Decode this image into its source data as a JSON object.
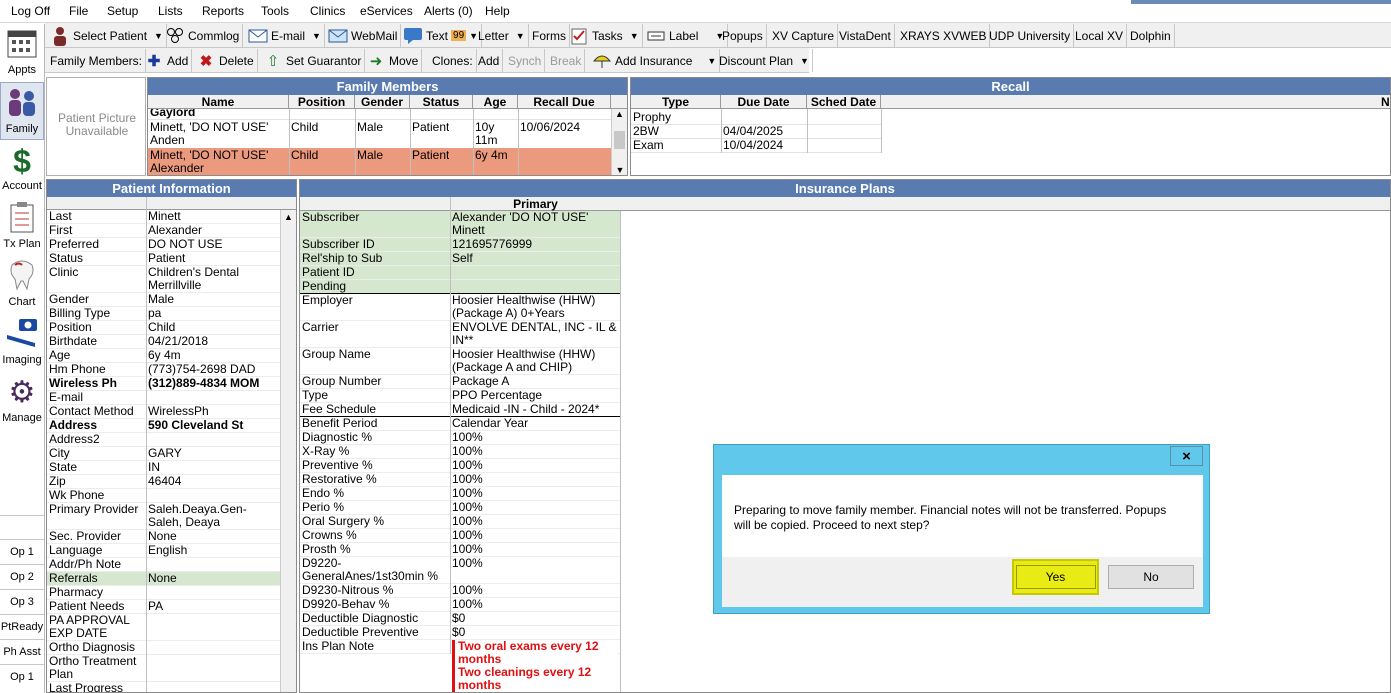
{
  "menu": {
    "items": [
      "Log Off",
      "File",
      "Setup",
      "Lists",
      "Reports",
      "Tools",
      "Clinics",
      "eServices",
      "Alerts (0)",
      "Help"
    ]
  },
  "toolbar_main": {
    "select_patient": "Select Patient",
    "commlog": "Commlog",
    "email": "E-mail",
    "webmail": "WebMail",
    "text": "Text",
    "text_badge": "99",
    "letter": "Letter",
    "forms": "Forms",
    "tasks": "Tasks",
    "label": "Label",
    "popups": "Popups",
    "xv_capture": "XV Capture",
    "vistadent": "VistaDent",
    "xrays": "XRAYS XVWEB",
    "udp": "UDP University",
    "local_xv": "Local XV",
    "dolphin": "Dolphin"
  },
  "toolbar_family": {
    "family_members": "Family Members:",
    "add": "Add",
    "delete": "Delete",
    "set_guarantor": "Set Guarantor",
    "move": "Move",
    "clones": "Clones:",
    "clone_add": "Add",
    "synch": "Synch",
    "break": "Break",
    "add_insurance": "Add Insurance",
    "discount_plan": "Discount Plan"
  },
  "modules": [
    "Appts",
    "Family",
    "Account",
    "Tx Plan",
    "Chart",
    "Imaging",
    "Manage"
  ],
  "op_buttons": [
    "Op 1",
    "Op 2",
    "Op 3",
    "PtReady",
    "Ph Asst",
    "Op 1"
  ],
  "patient_picture": "Patient Picture Unavailable",
  "family_members": {
    "title": "Family Members",
    "columns": [
      "Name",
      "Position",
      "Gender",
      "Status",
      "Age",
      "Recall Due"
    ],
    "partial_row": "Gaylord",
    "rows": [
      {
        "name": "Minett, 'DO NOT USE' Anden",
        "position": "Child",
        "gender": "Male",
        "status": "Patient",
        "age": "10y 11m",
        "recall": "10/06/2024"
      },
      {
        "name": "Minett, 'DO NOT USE' Alexander",
        "position": "Child",
        "gender": "Male",
        "status": "Patient",
        "age": "6y 4m",
        "recall": ""
      }
    ]
  },
  "recall": {
    "title": "Recall",
    "columns": [
      "Type",
      "Due Date",
      "Sched Date",
      "Not"
    ],
    "rows": [
      {
        "type": "Prophy",
        "due": "",
        "sched": ""
      },
      {
        "type": "2BW",
        "due": "04/04/2025",
        "sched": ""
      },
      {
        "type": "Exam",
        "due": "10/04/2024",
        "sched": ""
      }
    ]
  },
  "patient_info": {
    "title": "Patient Information",
    "rows": [
      {
        "label": "Last",
        "value": "Minett"
      },
      {
        "label": "First",
        "value": "Alexander"
      },
      {
        "label": "Preferred",
        "value": "DO NOT USE"
      },
      {
        "label": "Status",
        "value": "Patient"
      },
      {
        "label": "Clinic",
        "value": "Children's Dental Merrillville"
      },
      {
        "label": "Gender",
        "value": "Male"
      },
      {
        "label": "Billing Type",
        "value": "pa"
      },
      {
        "label": "Position",
        "value": "Child"
      },
      {
        "label": "Birthdate",
        "value": "04/21/2018"
      },
      {
        "label": "Age",
        "value": "6y 4m"
      },
      {
        "label": "Hm Phone",
        "value": "(773)754-2698 DAD"
      },
      {
        "label": "Wireless Ph",
        "value": "(312)889-4834 MOM"
      },
      {
        "label": "E-mail",
        "value": ""
      },
      {
        "label": "Contact Method",
        "value": "WirelessPh"
      },
      {
        "label": "Address",
        "value": "590 Cleveland St"
      },
      {
        "label": "Address2",
        "value": ""
      },
      {
        "label": "City",
        "value": "GARY"
      },
      {
        "label": "State",
        "value": "IN"
      },
      {
        "label": "Zip",
        "value": "46404"
      },
      {
        "label": "Wk Phone",
        "value": ""
      },
      {
        "label": "Primary Provider",
        "value": "Saleh.Deaya.Gen-Saleh, Deaya"
      },
      {
        "label": "Sec. Provider",
        "value": "None"
      },
      {
        "label": "Language",
        "value": "English"
      },
      {
        "label": "Addr/Ph Note",
        "value": ""
      },
      {
        "label": "Referrals",
        "value": "None"
      },
      {
        "label": "Pharmacy",
        "value": ""
      },
      {
        "label": "Patient Needs",
        "value": "PA"
      },
      {
        "label": "PA APPROVAL EXP DATE",
        "value": ""
      },
      {
        "label": "Ortho Diagnosis",
        "value": ""
      },
      {
        "label": "Ortho Treatment Plan",
        "value": ""
      },
      {
        "label": "Last Progress",
        "value": ""
      }
    ]
  },
  "insurance": {
    "title": "Insurance Plans",
    "column": "Primary",
    "rows": [
      {
        "label": "Subscriber",
        "value": "Alexander 'DO NOT USE' Minett"
      },
      {
        "label": "Subscriber ID",
        "value": "121695776999"
      },
      {
        "label": "Rel'ship to Sub",
        "value": "Self"
      },
      {
        "label": "Patient ID",
        "value": ""
      },
      {
        "label": "Pending",
        "value": ""
      },
      {
        "label": "Employer",
        "value": "Hoosier Healthwise (HHW) (Package A) 0+Years"
      },
      {
        "label": "Carrier",
        "value": "ENVOLVE DENTAL, INC - IL & IN**"
      },
      {
        "label": "Group Name",
        "value": "Hoosier Healthwise (HHW) (Package A and CHIP)"
      },
      {
        "label": "Group Number",
        "value": "Package A"
      },
      {
        "label": "Type",
        "value": "PPO Percentage"
      },
      {
        "label": "Fee Schedule",
        "value": "Medicaid -IN - Child - 2024*"
      },
      {
        "label": "Benefit Period",
        "value": "Calendar Year"
      },
      {
        "label": "Diagnostic %",
        "value": "100%"
      },
      {
        "label": "X-Ray %",
        "value": "100%"
      },
      {
        "label": "Preventive %",
        "value": "100%"
      },
      {
        "label": "Restorative %",
        "value": "100%"
      },
      {
        "label": "Endo %",
        "value": "100%"
      },
      {
        "label": "Perio %",
        "value": "100%"
      },
      {
        "label": "Oral Surgery %",
        "value": "100%"
      },
      {
        "label": "Crowns %",
        "value": "100%"
      },
      {
        "label": "Prosth %",
        "value": "100%"
      },
      {
        "label": "D9220-GeneralAnes/1st30min %",
        "value": "100%"
      },
      {
        "label": "D9230-Nitrous %",
        "value": "100%"
      },
      {
        "label": "D9920-Behav %",
        "value": "100%"
      },
      {
        "label": "Deductible Diagnostic",
        "value": "$0"
      },
      {
        "label": "Deductible Preventive",
        "value": "$0"
      },
      {
        "label": "Ins Plan Note",
        "value": ""
      }
    ],
    "notes": [
      "Two oral exams every 12 months",
      "Two cleanings every 12 months"
    ]
  },
  "dialog": {
    "close": "×",
    "message": "Preparing to move family member. Financial notes will not be transferred. Popups will be copied. Proceed to next step?",
    "yes": "Yes",
    "no": "No"
  },
  "colors": {
    "header_blue": "#5a7bb0",
    "selected_row": "#ec9a7e",
    "green_band": "#d6e7cf",
    "dialog_frame": "#60c8ea",
    "yes_highlight": "#e8ec14"
  }
}
